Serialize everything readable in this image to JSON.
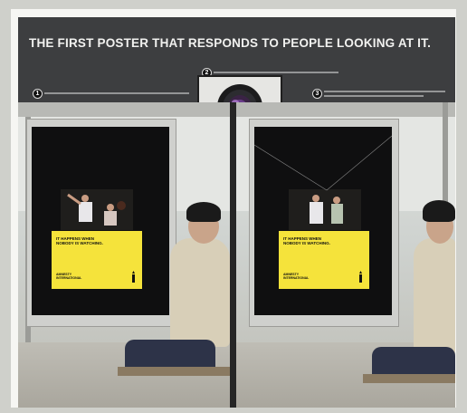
{
  "headline": "THE FIRST POSTER THAT RESPONDS TO PEOPLE LOOKING AT IT.",
  "steps": [
    {
      "number": "1",
      "text": ""
    },
    {
      "number": "2",
      "text": ""
    },
    {
      "number": "3",
      "text": ""
    }
  ],
  "poster": {
    "tagline": "IT HAPPENS WHEN\nNOBODY IS WATCHING.",
    "brand": "AMNESTY\nINTERNATIONAL"
  },
  "colors": {
    "board": "#3d3e40",
    "poster_yellow": "#f5e33b",
    "headline_text": "#f1f1ef"
  }
}
